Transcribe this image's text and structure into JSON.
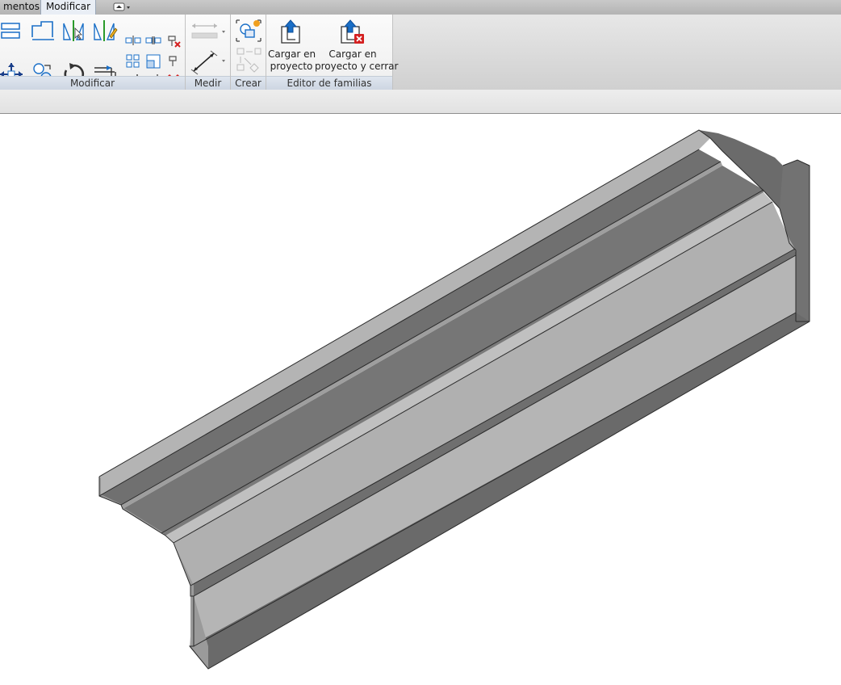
{
  "tabs": [
    {
      "label": "mentos",
      "active": false
    },
    {
      "label": "Modificar",
      "active": true
    }
  ],
  "quick_access": {
    "icon": "minimize-ribbon-icon",
    "dropdown": "chevron-down-icon"
  },
  "panels": {
    "modificar": {
      "title": "Modificar"
    },
    "medir": {
      "title": "Medir"
    },
    "crear": {
      "title": "Crear"
    },
    "editor": {
      "title": "Editor de familias"
    }
  },
  "buttons": {
    "load_into_project": {
      "label_line1": "Cargar en",
      "label_line2": "proyecto"
    },
    "load_and_close": {
      "label_line1": "Cargar en",
      "label_line2": "proyecto y cerrar"
    }
  },
  "colors": {
    "ribbon_bg": "#f3f3f3",
    "panel_title_bg": "#d4dce7",
    "model_light": "#b0b0b0",
    "model_mid": "#8a8a8a",
    "model_dark": "#666666",
    "delete_red": "#d42020",
    "icon_blue": "#1a6fc7"
  }
}
